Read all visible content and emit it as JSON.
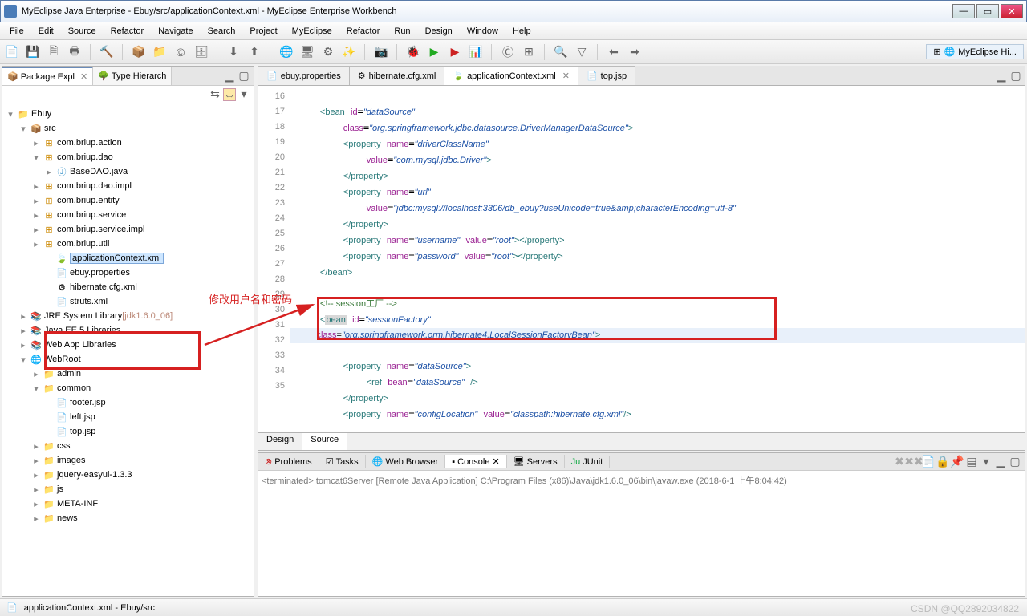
{
  "window": {
    "title": "MyEclipse Java Enterprise - Ebuy/src/applicationContext.xml - MyEclipse Enterprise Workbench"
  },
  "menus": [
    "File",
    "Edit",
    "Source",
    "Refactor",
    "Navigate",
    "Search",
    "Project",
    "MyEclipse",
    "Refactor",
    "Run",
    "Design",
    "Window",
    "Help"
  ],
  "perspective": "MyEclipse Hi...",
  "sidebar": {
    "tab1": "Package Expl",
    "tab2": "Type Hierarch",
    "project": "Ebuy",
    "src": "src",
    "packages": [
      "com.briup.action",
      "com.briup.dao",
      "com.briup.dao.impl",
      "com.briup.entity",
      "com.briup.service",
      "com.briup.service.impl",
      "com.briup.util"
    ],
    "basedao": "BaseDAO.java",
    "appctx": "applicationContext.xml",
    "ebuyprops": "ebuy.properties",
    "hibcfg": "hibernate.cfg.xml",
    "struts": "struts.xml",
    "jre": "JRE System Library",
    "jrever": "[jdk1.6.0_06]",
    "javaee": "Java EE 5 Libraries",
    "webapp": "Web App Libraries",
    "webroot": "WebRoot",
    "webfolders": [
      "admin",
      "common",
      "css",
      "images",
      "jquery-easyui-1.3.3",
      "js",
      "META-INF",
      "news"
    ],
    "jsps": [
      "footer.jsp",
      "left.jsp",
      "top.jsp"
    ]
  },
  "editor": {
    "tabs": [
      "ebuy.properties",
      "hibernate.cfg.xml",
      "applicationContext.xml",
      "top.jsp"
    ],
    "activeTab": 2,
    "bottomTabs": [
      "Design",
      "Source"
    ]
  },
  "code": {
    "l16": "16",
    "l17": "17",
    "l18": "18",
    "l19": "19",
    "l20": "20",
    "l21": "21",
    "l22": "22",
    "l23": "23",
    "l24": "24",
    "l25": "25",
    "l26": "26",
    "l27": "27",
    "l28": "28",
    "l29": "29",
    "l30": "30",
    "l31": "31",
    "l32": "32",
    "l33": "33",
    "l34": "34",
    "l35": "35"
  },
  "annotation": "修改用户名和密码",
  "console": {
    "tabs": [
      "Problems",
      "Tasks",
      "Web Browser",
      "Console",
      "Servers",
      "JUnit"
    ],
    "activeTab": 3,
    "status": "<terminated> tomcat6Server [Remote Java Application] C:\\Program Files (x86)\\Java\\jdk1.6.0_06\\bin\\javaw.exe (2018-6-1 上午8:04:42)"
  },
  "status": {
    "path": "applicationContext.xml - Ebuy/src"
  },
  "watermark": "CSDN @QQ2892034822"
}
